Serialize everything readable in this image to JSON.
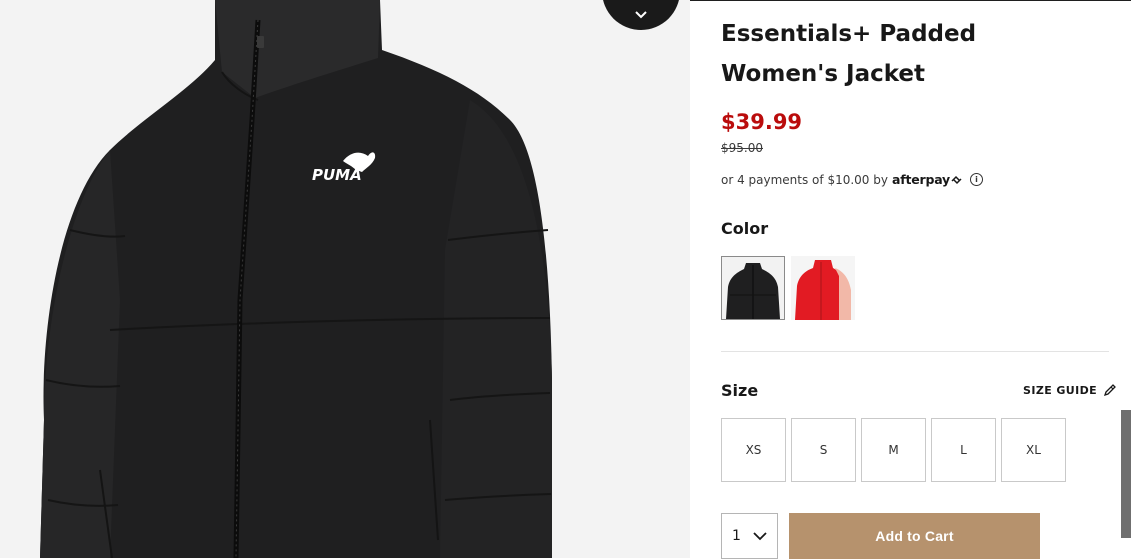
{
  "product": {
    "title": "Essentials+ Padded Women's Jacket",
    "price": "$39.99",
    "original_price": "$95.00",
    "afterpay_text": "or 4 payments of $10.00 by",
    "afterpay_logo": "afterpay",
    "info_symbol": "i"
  },
  "color": {
    "label": "Color",
    "swatches": [
      {
        "name": "black",
        "selected": true,
        "hex": "#1f1f20"
      },
      {
        "name": "red/pink",
        "selected": false,
        "hex": "#e21b23"
      }
    ]
  },
  "size": {
    "label": "Size",
    "guide_label": "SIZE GUIDE",
    "options": [
      "XS",
      "S",
      "M",
      "L",
      "XL"
    ]
  },
  "cart": {
    "quantity": "1",
    "add_label": "Add to Cart"
  },
  "gallery": {
    "brand_mark": "PUMA"
  },
  "colors": {
    "sale": "#ba0c0c",
    "cta": "#b6926d",
    "jacket": "#1f1f20"
  }
}
